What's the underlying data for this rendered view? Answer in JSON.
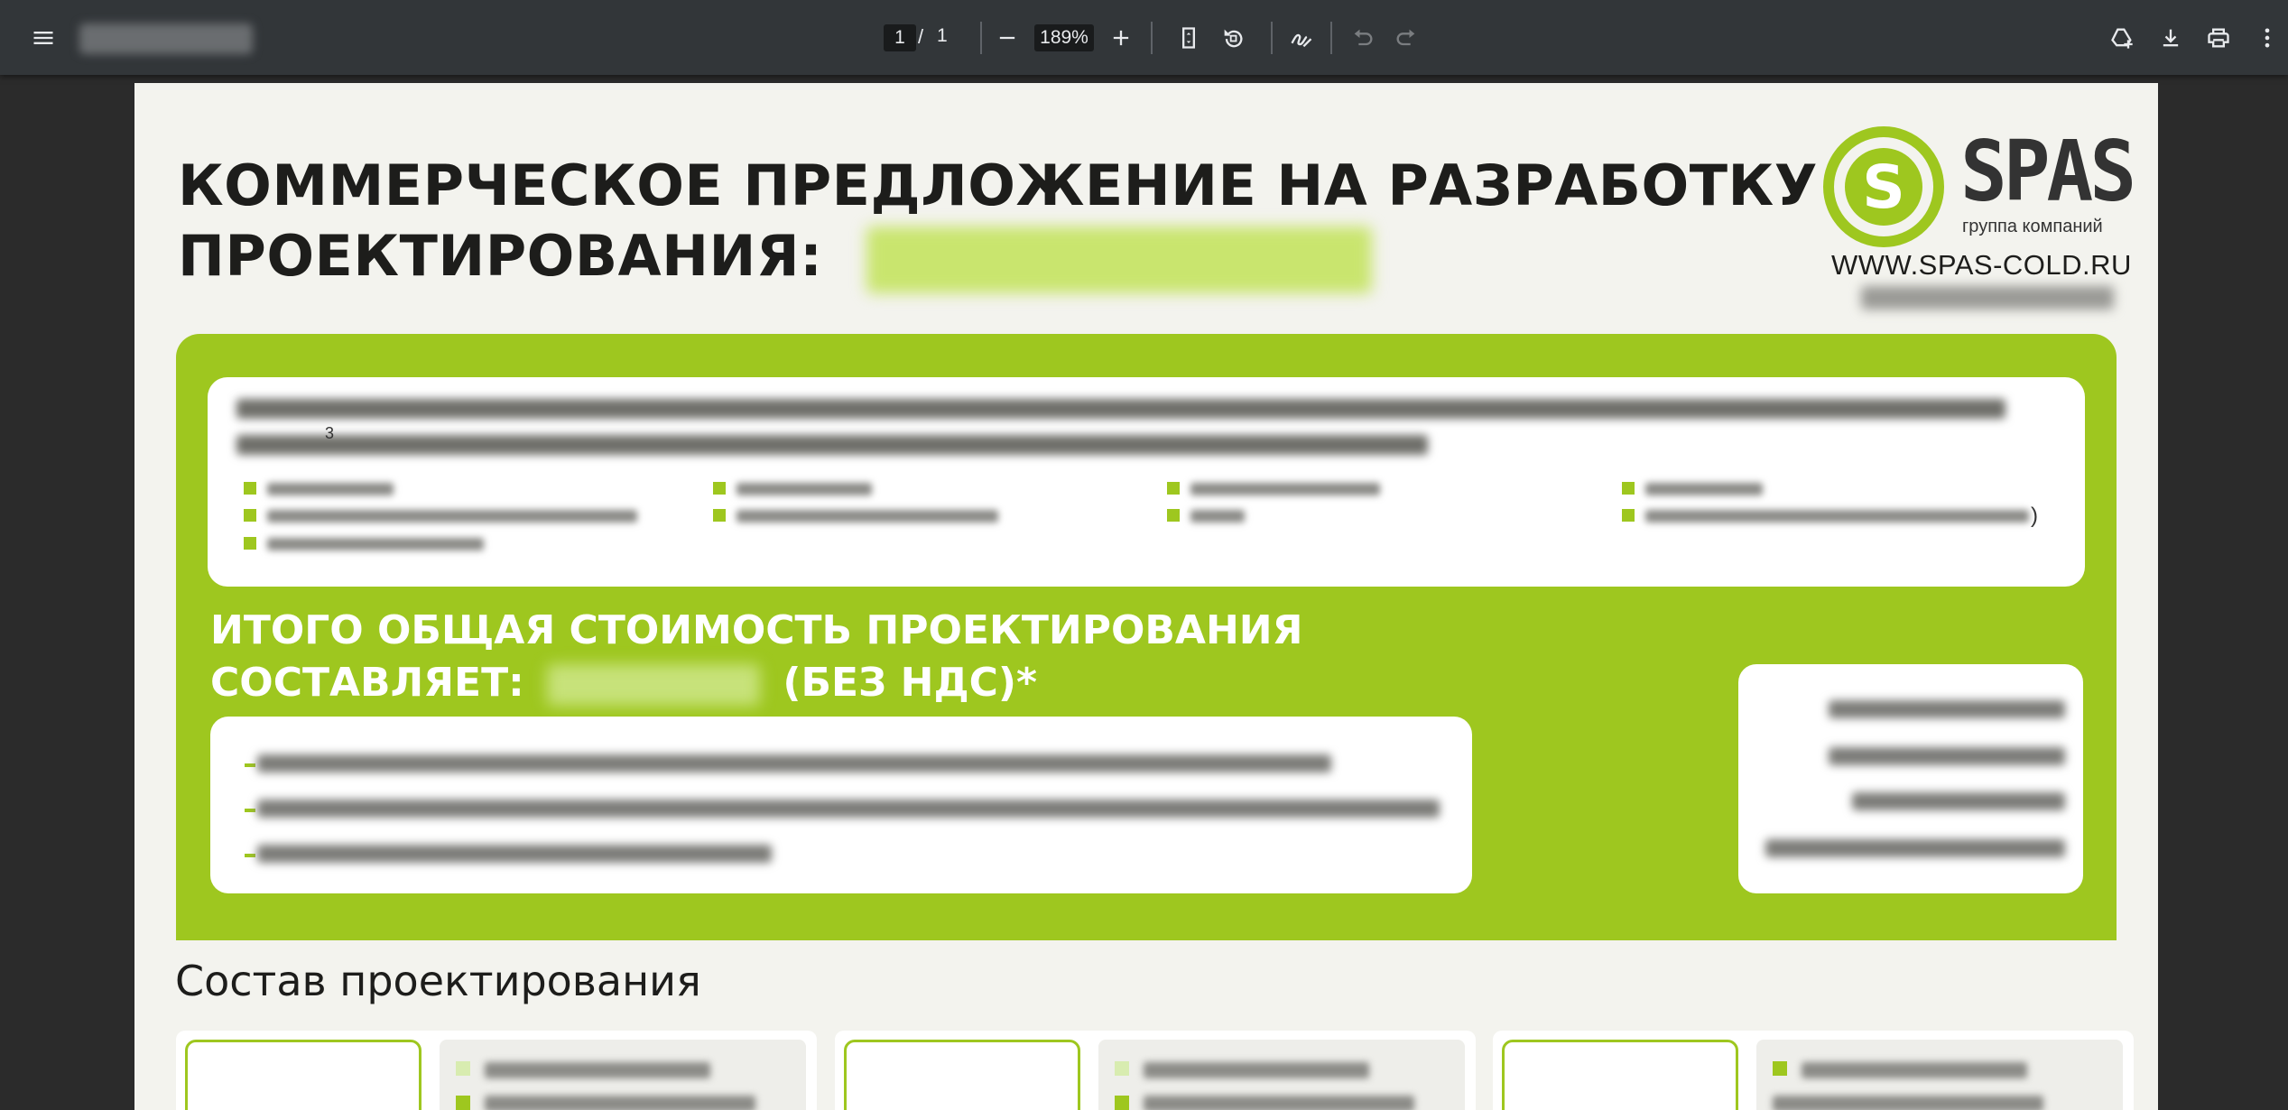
{
  "viewer": {
    "current_page": "1",
    "page_separator": "/",
    "total_pages": "1",
    "zoom": "189%",
    "icons": {
      "menu": "menu-icon",
      "zoom_out": "minus-icon",
      "zoom_in": "plus-icon",
      "fit_page": "fit-page-icon",
      "rotate": "rotate-icon",
      "annotate": "draw-icon",
      "undo": "undo-icon",
      "redo": "redo-icon",
      "save_to_drive": "drive-add-icon",
      "download": "download-icon",
      "print": "print-icon",
      "more": "more-vert-icon"
    }
  },
  "document": {
    "title_line1": "КОММЕРЧЕСКОЕ ПРЕДЛОЖЕНИЕ НА РАЗРАБОТКУ",
    "title_line2": "ПРОЕКТИРОВАНИЯ:",
    "logo": {
      "mark": "S",
      "name": "SPAS",
      "tagline": "группа компаний"
    },
    "website": "WWW.SPAS-COLD.RU",
    "area_unit_superscript": "3",
    "list_trailing_paren": ")",
    "total_line1": "ИТОГО ОБЩАЯ СТОИМОСТЬ ПРОЕКТИРОВАНИЯ",
    "total_line2_prefix": "СОСТАВЛЯЕТ:",
    "total_line2_suffix": "(БЕЗ НДС)*",
    "section_title": "Состав проектирования"
  },
  "colors": {
    "brand_green": "#9ec71f",
    "page_background": "#f3f3ee",
    "toolbar": "#323639",
    "viewer_background": "#2b2b2b"
  }
}
